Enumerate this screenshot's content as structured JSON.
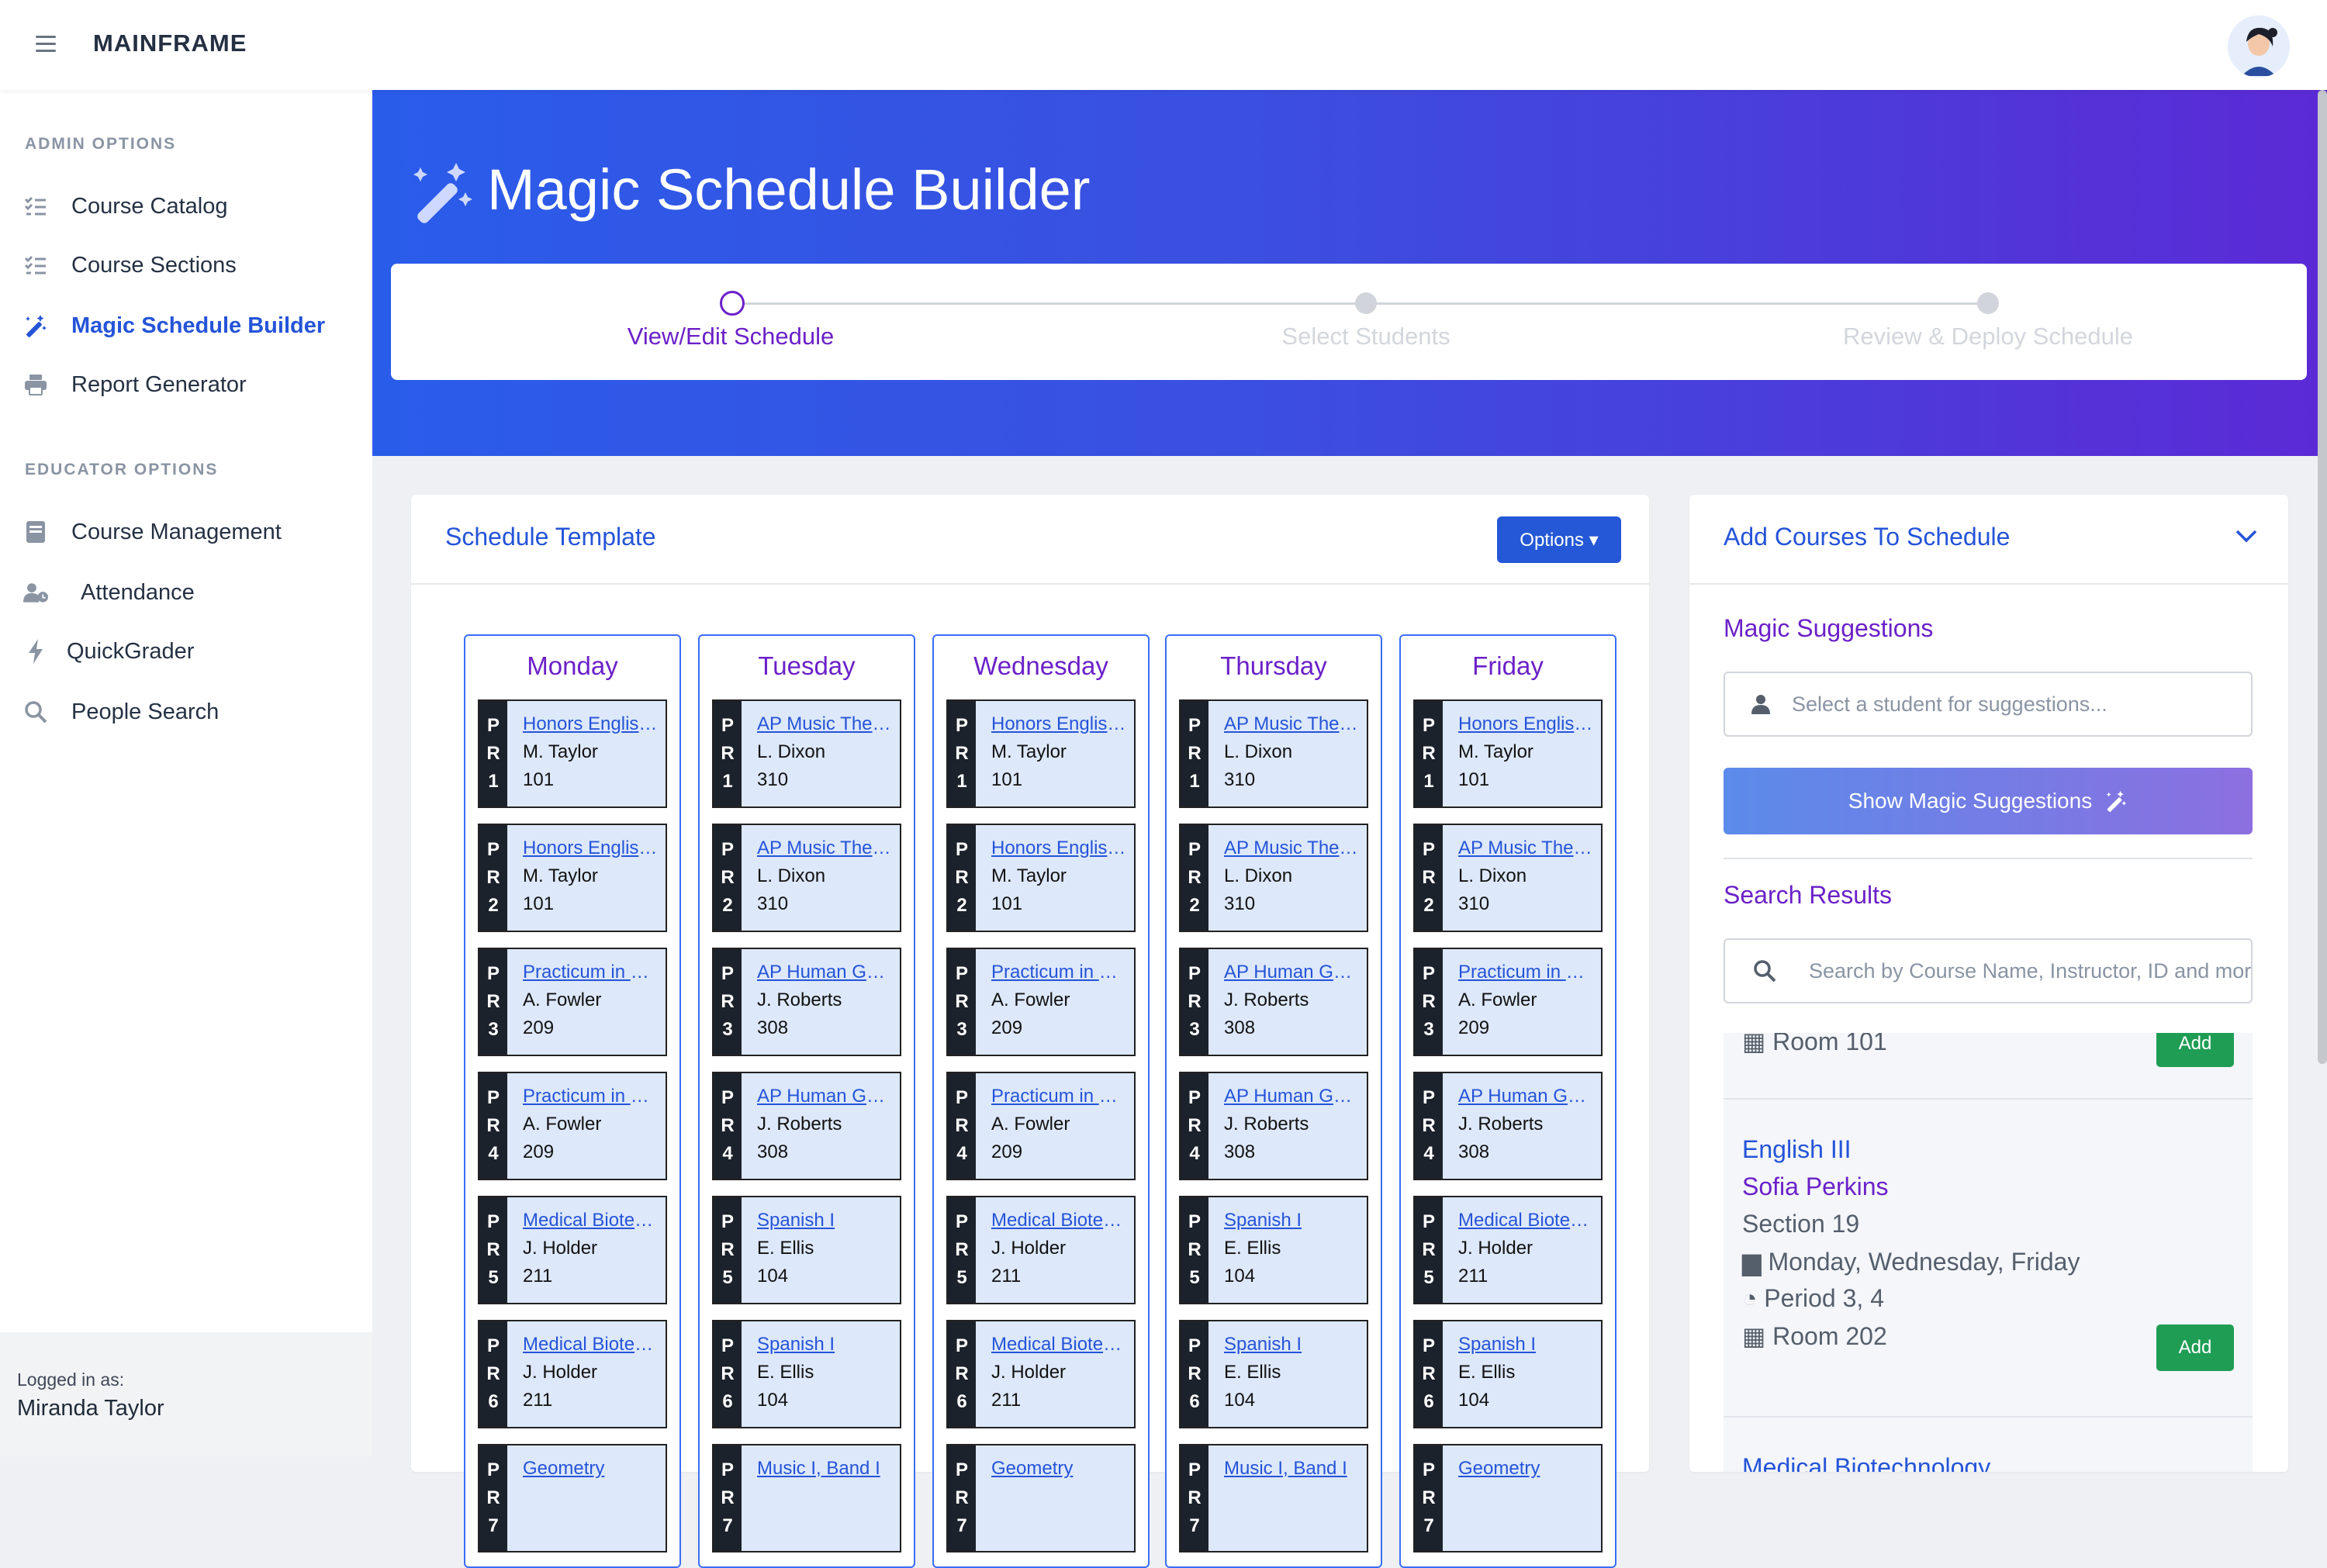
{
  "app": {
    "brand": "MAINFRAME"
  },
  "sidebar": {
    "admin_heading": "ADMIN OPTIONS",
    "educator_heading": "EDUCATOR OPTIONS",
    "admin_items": [
      {
        "label": "Course Catalog",
        "icon": "list-check-icon"
      },
      {
        "label": "Course Sections",
        "icon": "list-check-icon"
      },
      {
        "label": "Magic Schedule Builder",
        "icon": "magic-wand-icon",
        "active": true
      },
      {
        "label": "Report Generator",
        "icon": "printer-icon"
      }
    ],
    "educator_items": [
      {
        "label": "Course Management",
        "icon": "book-icon"
      },
      {
        "label": "Attendance",
        "icon": "user-clock-icon"
      },
      {
        "label": "QuickGrader",
        "icon": "bolt-icon"
      },
      {
        "label": "People Search",
        "icon": "search-icon"
      }
    ],
    "footer": {
      "logged_in_label": "Logged in as:",
      "user_name": "Miranda Taylor"
    }
  },
  "hero": {
    "title": "Magic Schedule Builder",
    "steps": [
      {
        "label": "View/Edit Schedule",
        "state": "active"
      },
      {
        "label": "Select Students",
        "state": "inactive"
      },
      {
        "label": "Review & Deploy Schedule",
        "state": "inactive"
      }
    ]
  },
  "schedule": {
    "title": "Schedule Template",
    "options_label": "Options ▾",
    "days": [
      {
        "name": "Monday",
        "slots": [
          {
            "period": "1",
            "course": "Honors English I",
            "teacher": "M. Taylor",
            "room": "101"
          },
          {
            "period": "2",
            "course": "Honors English I",
            "teacher": "M. Taylor",
            "room": "101"
          },
          {
            "period": "3",
            "course": "Practicum in Health Science",
            "teacher": "A. Fowler",
            "room": "209"
          },
          {
            "period": "4",
            "course": "Practicum in Health Science",
            "teacher": "A. Fowler",
            "room": "209"
          },
          {
            "period": "5",
            "course": "Medical Biotechnology",
            "teacher": "J. Holder",
            "room": "211"
          },
          {
            "period": "6",
            "course": "Medical Biotechnology",
            "teacher": "J. Holder",
            "room": "211"
          },
          {
            "period": "7",
            "course": "Geometry",
            "teacher": "",
            "room": ""
          }
        ]
      },
      {
        "name": "Tuesday",
        "slots": [
          {
            "period": "1",
            "course": "AP Music Theory",
            "teacher": "L. Dixon",
            "room": "310"
          },
          {
            "period": "2",
            "course": "AP Music Theory",
            "teacher": "L. Dixon",
            "room": "310"
          },
          {
            "period": "3",
            "course": "AP Human Geography",
            "teacher": "J. Roberts",
            "room": "308"
          },
          {
            "period": "4",
            "course": "AP Human Geography",
            "teacher": "J. Roberts",
            "room": "308"
          },
          {
            "period": "5",
            "course": "Spanish I",
            "teacher": "E. Ellis",
            "room": "104"
          },
          {
            "period": "6",
            "course": "Spanish I",
            "teacher": "E. Ellis",
            "room": "104"
          },
          {
            "period": "7",
            "course": "Music I, Band I",
            "teacher": "",
            "room": ""
          }
        ]
      },
      {
        "name": "Wednesday",
        "slots": [
          {
            "period": "1",
            "course": "Honors English I",
            "teacher": "M. Taylor",
            "room": "101"
          },
          {
            "period": "2",
            "course": "Honors English I",
            "teacher": "M. Taylor",
            "room": "101"
          },
          {
            "period": "3",
            "course": "Practicum in Health Science",
            "teacher": "A. Fowler",
            "room": "209"
          },
          {
            "period": "4",
            "course": "Practicum in Health Science",
            "teacher": "A. Fowler",
            "room": "209"
          },
          {
            "period": "5",
            "course": "Medical Biotechnology",
            "teacher": "J. Holder",
            "room": "211"
          },
          {
            "period": "6",
            "course": "Medical Biotechnology",
            "teacher": "J. Holder",
            "room": "211"
          },
          {
            "period": "7",
            "course": "Geometry",
            "teacher": "",
            "room": ""
          }
        ]
      },
      {
        "name": "Thursday",
        "slots": [
          {
            "period": "1",
            "course": "AP Music Theory",
            "teacher": "L. Dixon",
            "room": "310"
          },
          {
            "period": "2",
            "course": "AP Music Theory",
            "teacher": "L. Dixon",
            "room": "310"
          },
          {
            "period": "3",
            "course": "AP Human Geography",
            "teacher": "J. Roberts",
            "room": "308"
          },
          {
            "period": "4",
            "course": "AP Human Geography",
            "teacher": "J. Roberts",
            "room": "308"
          },
          {
            "period": "5",
            "course": "Spanish I",
            "teacher": "E. Ellis",
            "room": "104"
          },
          {
            "period": "6",
            "course": "Spanish I",
            "teacher": "E. Ellis",
            "room": "104"
          },
          {
            "period": "7",
            "course": "Music I, Band I",
            "teacher": "",
            "room": ""
          }
        ]
      },
      {
        "name": "Friday",
        "slots": [
          {
            "period": "1",
            "course": "Honors English I",
            "teacher": "M. Taylor",
            "room": "101"
          },
          {
            "period": "2",
            "course": "AP Music Theory",
            "teacher": "L. Dixon",
            "room": "310"
          },
          {
            "period": "3",
            "course": "Practicum in Health Science",
            "teacher": "A. Fowler",
            "room": "209"
          },
          {
            "period": "4",
            "course": "AP Human Geography",
            "teacher": "J. Roberts",
            "room": "308"
          },
          {
            "period": "5",
            "course": "Medical Biotechnology",
            "teacher": "J. Holder",
            "room": "211"
          },
          {
            "period": "6",
            "course": "Spanish I",
            "teacher": "E. Ellis",
            "room": "104"
          },
          {
            "period": "7",
            "course": "Geometry",
            "teacher": "",
            "room": ""
          }
        ]
      }
    ]
  },
  "add_courses": {
    "title": "Add Courses To Schedule",
    "magic_heading": "Magic Suggestions",
    "student_placeholder": "Select a student for suggestions...",
    "magic_button": "Show Magic Suggestions",
    "results_heading": "Search Results",
    "search_placeholder": "Search by Course Name, Instructor, ID and more",
    "results": [
      {
        "room": "Room 101",
        "add_label": "Add"
      },
      {
        "course": "English III",
        "instructor": "Sofia Perkins",
        "section": "Section 19",
        "days": "Monday, Wednesday, Friday",
        "periods": "Period 3, 4",
        "room": "Room 202",
        "add_label": "Add"
      },
      {
        "course": "Medical Biotechnology"
      }
    ]
  },
  "colors": {
    "accent": "#2554d8",
    "purple": "#6b21c8",
    "add_green": "#1f9d55",
    "slot_bg": "#dde8fb"
  }
}
